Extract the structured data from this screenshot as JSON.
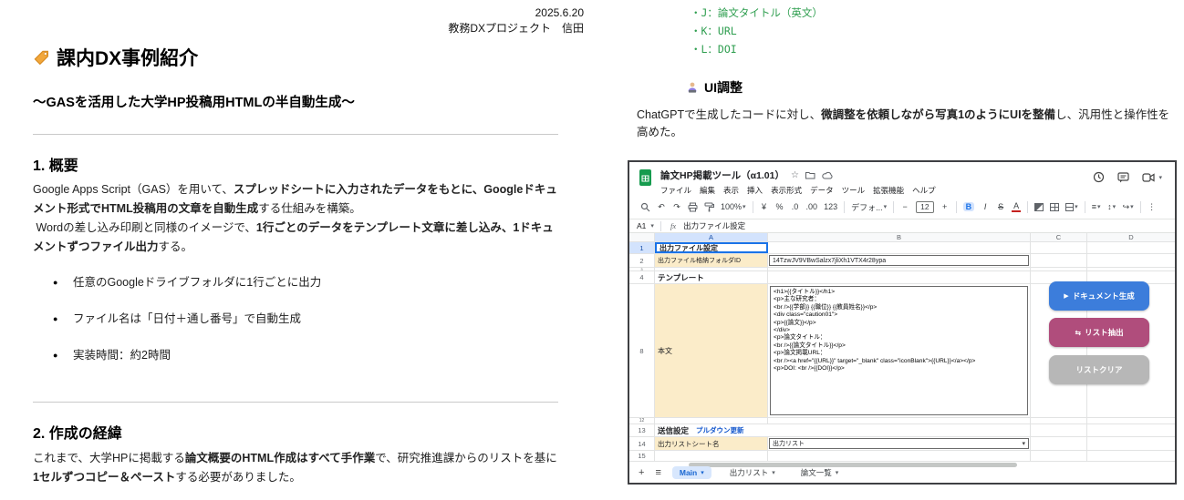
{
  "doc": {
    "date": "2025.6.20",
    "byline": "教務DXプロジェクト　信田",
    "title": "課内DX事例紹介",
    "subtitle": "～GASを活用した大学HP投稿用HTMLの半自動生成～",
    "section1_heading": "1. 概要",
    "p1": {
      "s0": "Google Apps Script（GAS）を用いて、",
      "s1": "スプレッドシートに入力されたデータをもとに、Googleドキュメント形式でHTML投稿用の文章を自動生成",
      "s2": "する仕組みを構築。",
      "s3": " Wordの差し込み印刷と同様のイメージで、",
      "s4": "1行ごとのデータをテンプレート文章に差し込み、1ドキュメントずつファイル出力",
      "s5": "する。"
    },
    "bullets": [
      "任意のGoogleドライブフォルダに1行ごとに出力",
      "ファイル名は「日付＋通し番号」で自動生成",
      "実装時間：約2時間"
    ],
    "section2_heading": "2. 作成の経緯",
    "p2": {
      "s0": "これまで、大学HPに掲載する",
      "s1": "論文概要のHTML作成はすべて手作業",
      "s2": "で、研究推進課からのリストを基に",
      "s3": "1セルずつコピー＆ペースト",
      "s4": "する必要がありました。"
    }
  },
  "right": {
    "code_lines": [
      "・J：論文タイトル（英文）",
      "・K：URL",
      "・L：DOI"
    ],
    "code_color": "#2e9e4f",
    "ui_heading": "UI調整",
    "p1": {
      "s0": "ChatGPTで生成したコードに対し、",
      "s1": "微調整を依頼しながら写真1のようにUIを整備",
      "s2": "し、汎用性と操作性を高めた。"
    }
  },
  "sheet": {
    "title": "論文HP掲載ツール（α1.01）",
    "menus": [
      "ファイル",
      "編集",
      "表示",
      "挿入",
      "表示形式",
      "データ",
      "ツール",
      "拡張機能",
      "ヘルプ"
    ],
    "toolbar": {
      "undo": "↶",
      "redo": "↷",
      "zoom": "100%",
      "currency": "¥",
      "percent": "%",
      "dec_dec": ".0",
      "inc_dec": ".00",
      "num_fmt": "123",
      "font": "デフォ...",
      "minus": "−",
      "size": "12",
      "plus": "+",
      "bold": "B",
      "italic": "I",
      "strike": "S",
      "color": "A",
      "align": "≡",
      "valign": "↕",
      "wrap": "↪",
      "more": "⋮"
    },
    "name_box": "A1",
    "fx_label": "fx",
    "formula": "出力ファイル設定",
    "columns": [
      "A",
      "B",
      "C",
      "D"
    ],
    "rows": {
      "r1": {
        "n": "1",
        "a": "出力ファイル設定"
      },
      "r2": {
        "n": "2",
        "a": "出力ファイル格納フォルダID",
        "b": "14TzwJV9VBwSalzx7jliXh1VTX4r28ypa"
      },
      "r3": {
        "n": "3"
      },
      "r4": {
        "n": "4",
        "a": "テンプレート"
      },
      "r8": {
        "n": "8",
        "a": "本文"
      },
      "r12": {
        "n": "12"
      },
      "r13": {
        "n": "13",
        "a": "送信設定",
        "link": "プルダウン更新"
      },
      "r14": {
        "n": "14",
        "a": "出力リストシート名",
        "b": "出力リスト"
      },
      "r15": {
        "n": "15"
      }
    },
    "template_lines": [
      "<h1>{{タイトル}}</h1>",
      "<p>主な研究者：",
      "<br />{{学部}} {{職位}} {{教員姓名}}</p>",
      "<div class=\"caution01\">",
      "<p>{{論文}}</p>",
      "</div>",
      "<p>論文タイトル：",
      "<br />{{論文タイトル}}</p>",
      "<p>論文掲載URL：",
      "<br /><a href=\"{{URL}}\" target=\"_blank\" class=\"iconBlank\">{{URL}}</a></p>",
      "<p>DOI: <br />{{DOI}}</p>"
    ],
    "buttons": {
      "generate": "ドキュメント生成",
      "generate_icon": "▶",
      "generate_color": "#3c7ddb",
      "extract": "リスト抽出",
      "extract_icon": "⇆",
      "extract_color": "#b04d7c",
      "clear": "リストクリア",
      "clear_color": "#b7b7b7"
    },
    "tabs": {
      "add": "+",
      "all": "≡",
      "active": "Main",
      "others": [
        "出力リスト",
        "論文一覧"
      ],
      "caret": "▾"
    }
  }
}
